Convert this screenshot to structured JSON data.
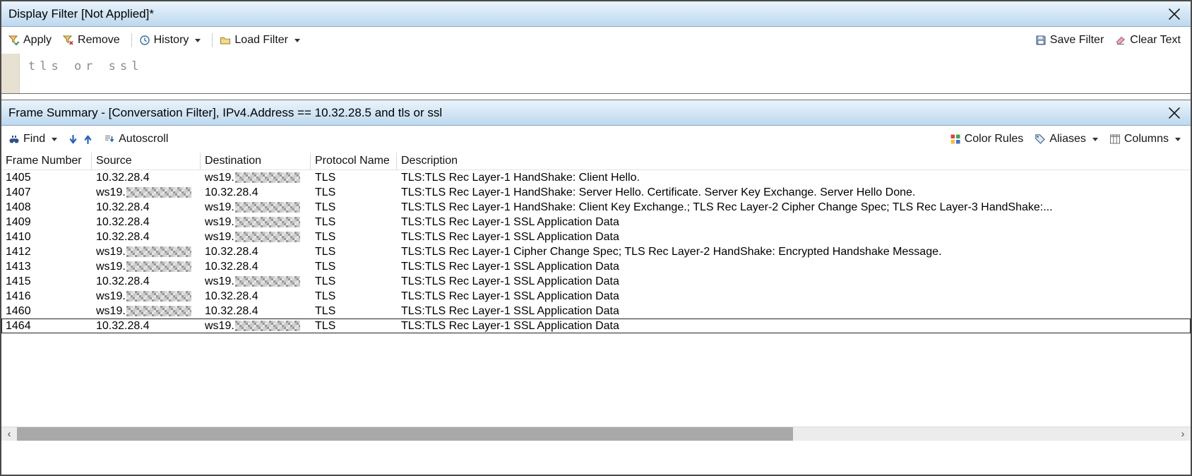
{
  "display_filter": {
    "title": "Display Filter [Not Applied]*",
    "toolbar": {
      "apply": "Apply",
      "remove": "Remove",
      "history": "History",
      "load_filter": "Load Filter",
      "save_filter": "Save Filter",
      "clear_text": "Clear Text"
    },
    "filter_text": "tls or ssl"
  },
  "frame_summary": {
    "title": "Frame Summary - [Conversation Filter], IPv4.Address == 10.32.28.5 and tls or ssl",
    "toolbar": {
      "find": "Find",
      "autoscroll": "Autoscroll",
      "color_rules": "Color Rules",
      "aliases": "Aliases",
      "columns": "Columns"
    },
    "table": {
      "columns": [
        "Frame Number",
        "Source",
        "Destination",
        "Protocol Name",
        "Description"
      ],
      "rows": [
        {
          "frame_number": "1405",
          "source": "10.32.28.4",
          "source_redacted": false,
          "destination": "ws19.",
          "destination_redacted": true,
          "protocol_name": "TLS",
          "description": "TLS:TLS Rec Layer-1 HandShake: Client Hello.",
          "selected": false
        },
        {
          "frame_number": "1407",
          "source": "ws19.",
          "source_redacted": true,
          "destination": "10.32.28.4",
          "destination_redacted": false,
          "protocol_name": "TLS",
          "description": "TLS:TLS Rec Layer-1 HandShake: Server Hello. Certificate. Server Key Exchange. Server Hello Done.",
          "selected": false
        },
        {
          "frame_number": "1408",
          "source": "10.32.28.4",
          "source_redacted": false,
          "destination": "ws19.",
          "destination_redacted": true,
          "protocol_name": "TLS",
          "description": "TLS:TLS Rec Layer-1 HandShake: Client Key Exchange.; TLS Rec Layer-2 Cipher Change Spec; TLS Rec Layer-3 HandShake:...",
          "selected": false
        },
        {
          "frame_number": "1409",
          "source": "10.32.28.4",
          "source_redacted": false,
          "destination": "ws19.",
          "destination_redacted": true,
          "protocol_name": "TLS",
          "description": "TLS:TLS Rec Layer-1 SSL Application Data",
          "selected": false
        },
        {
          "frame_number": "1410",
          "source": "10.32.28.4",
          "source_redacted": false,
          "destination": "ws19.",
          "destination_redacted": true,
          "protocol_name": "TLS",
          "description": "TLS:TLS Rec Layer-1 SSL Application Data",
          "selected": false
        },
        {
          "frame_number": "1412",
          "source": "ws19.",
          "source_redacted": true,
          "destination": "10.32.28.4",
          "destination_redacted": false,
          "protocol_name": "TLS",
          "description": "TLS:TLS Rec Layer-1 Cipher Change Spec; TLS Rec Layer-2 HandShake: Encrypted Handshake Message.",
          "selected": false
        },
        {
          "frame_number": "1413",
          "source": "ws19.",
          "source_redacted": true,
          "destination": "10.32.28.4",
          "destination_redacted": false,
          "protocol_name": "TLS",
          "description": "TLS:TLS Rec Layer-1 SSL Application Data",
          "selected": false
        },
        {
          "frame_number": "1415",
          "source": "10.32.28.4",
          "source_redacted": false,
          "destination": "ws19.",
          "destination_redacted": true,
          "protocol_name": "TLS",
          "description": "TLS:TLS Rec Layer-1 SSL Application Data",
          "selected": false
        },
        {
          "frame_number": "1416",
          "source": "ws19.",
          "source_redacted": true,
          "destination": "10.32.28.4",
          "destination_redacted": false,
          "protocol_name": "TLS",
          "description": "TLS:TLS Rec Layer-1 SSL Application Data",
          "selected": false
        },
        {
          "frame_number": "1460",
          "source": "ws19.",
          "source_redacted": true,
          "destination": "10.32.28.4",
          "destination_redacted": false,
          "protocol_name": "TLS",
          "description": "TLS:TLS Rec Layer-1 SSL Application Data",
          "selected": false
        },
        {
          "frame_number": "1464",
          "source": "10.32.28.4",
          "source_redacted": false,
          "destination": "ws19.",
          "destination_redacted": true,
          "protocol_name": "TLS",
          "description": "TLS:TLS Rec Layer-1 SSL Application Data",
          "selected": true
        }
      ]
    }
  },
  "scrollbar": {
    "left_arrow": "‹",
    "right_arrow": "›"
  },
  "colors": {
    "titlebar_gradient_top": "#eaf4fc",
    "titlebar_gradient_bottom": "#bdd8ee",
    "editor_gutter": "#e7e1d1",
    "filter_text": "#8c8c8c",
    "selection_outline": "#222222"
  }
}
